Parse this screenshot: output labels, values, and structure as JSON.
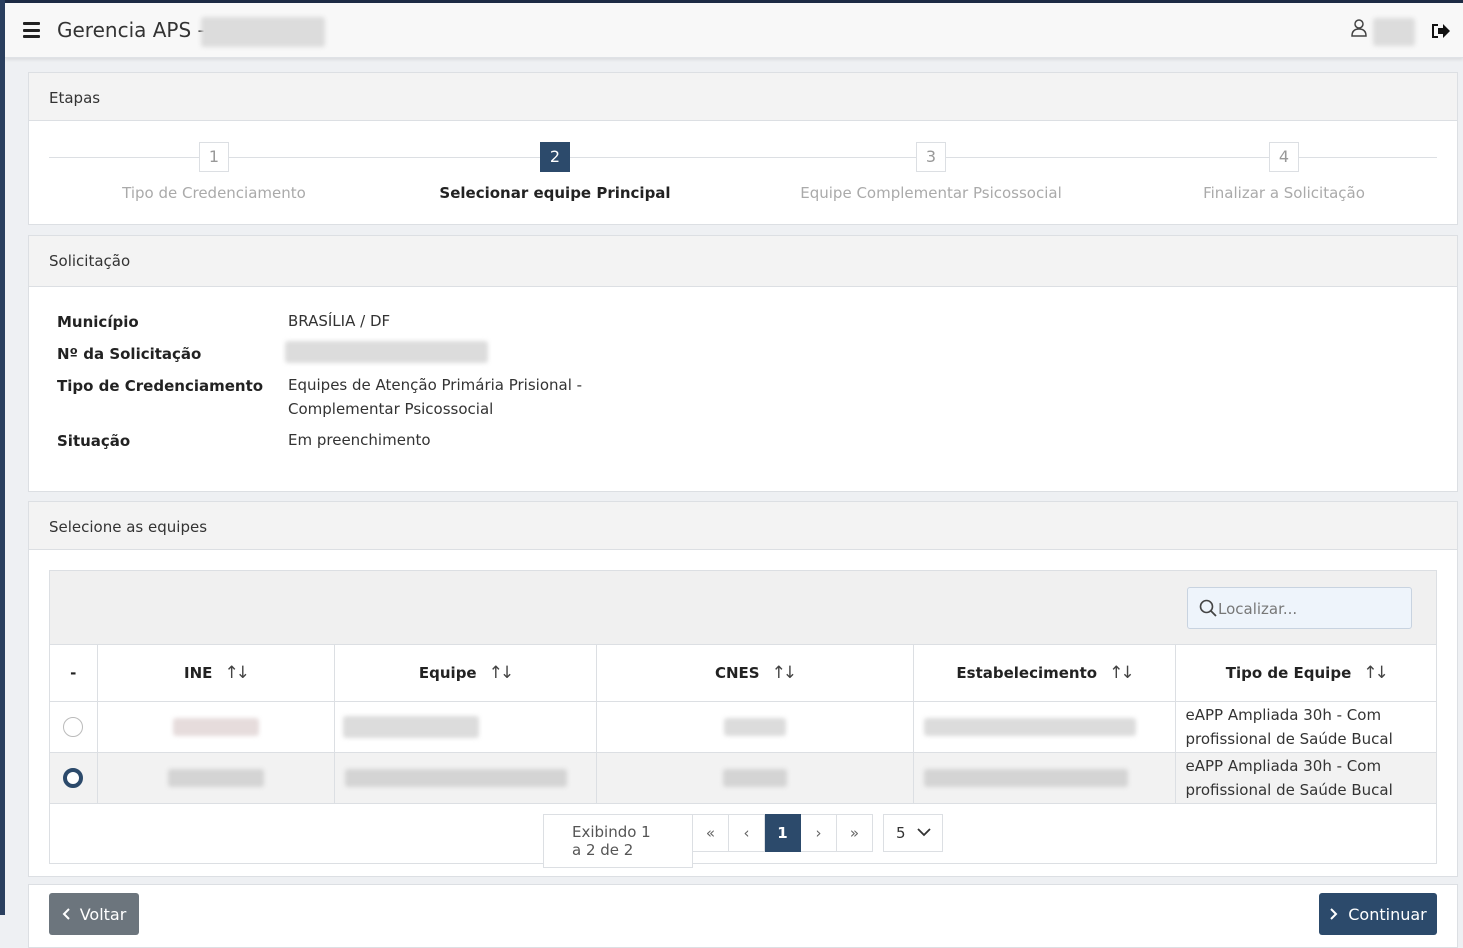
{
  "header": {
    "title": "Gerencia APS -",
    "icons": {
      "menu": "hamburger-icon",
      "user": "user-icon",
      "logout": "logout-icon"
    }
  },
  "steps": {
    "heading": "Etapas",
    "items": [
      {
        "number": "1",
        "label": "Tipo de Credenciamento",
        "active": false
      },
      {
        "number": "2",
        "label": "Selecionar equipe Principal",
        "active": true
      },
      {
        "number": "3",
        "label": "Equipe Complementar Psicossocial",
        "active": false
      },
      {
        "number": "4",
        "label": "Finalizar a Solicitação",
        "active": false
      }
    ]
  },
  "solicitacao": {
    "heading": "Solicitação",
    "municipio_label": "Município",
    "municipio_value": "BRASÍLIA / DF",
    "numero_label": "Nº da Solicitação",
    "tipo_label": "Tipo de Credenciamento",
    "tipo_value_line1": "Equipes de Atenção Primária Prisional -",
    "tipo_value_line2": "Complementar Psicossocial",
    "situacao_label": "Situação",
    "situacao_value": "Em preenchimento"
  },
  "equipes": {
    "heading": "Selecione as equipes",
    "search_placeholder": "Localizar...",
    "columns": [
      "-",
      "INE",
      "Equipe",
      "CNES",
      "Estabelecimento",
      "Tipo de Equipe"
    ],
    "rows": [
      {
        "selected": false,
        "tipo_line1": "eAPP Ampliada 30h - Com",
        "tipo_line2": "profissional de Saúde Bucal"
      },
      {
        "selected": true,
        "tipo_line1": "eAPP Ampliada 30h - Com",
        "tipo_line2": "profissional de Saúde Bucal"
      }
    ],
    "pagination": {
      "info": "Exibindo 1 a 2 de 2",
      "first": "«",
      "prev": "‹",
      "current_page": "1",
      "next": "›",
      "last": "»",
      "page_size": "5"
    }
  },
  "footer": {
    "back_label": "Voltar",
    "continue_label": "Continuar"
  },
  "colors": {
    "primary": "#2c4a6b",
    "secondary": "#6c757d",
    "header_bg": "#f3f3f3"
  }
}
